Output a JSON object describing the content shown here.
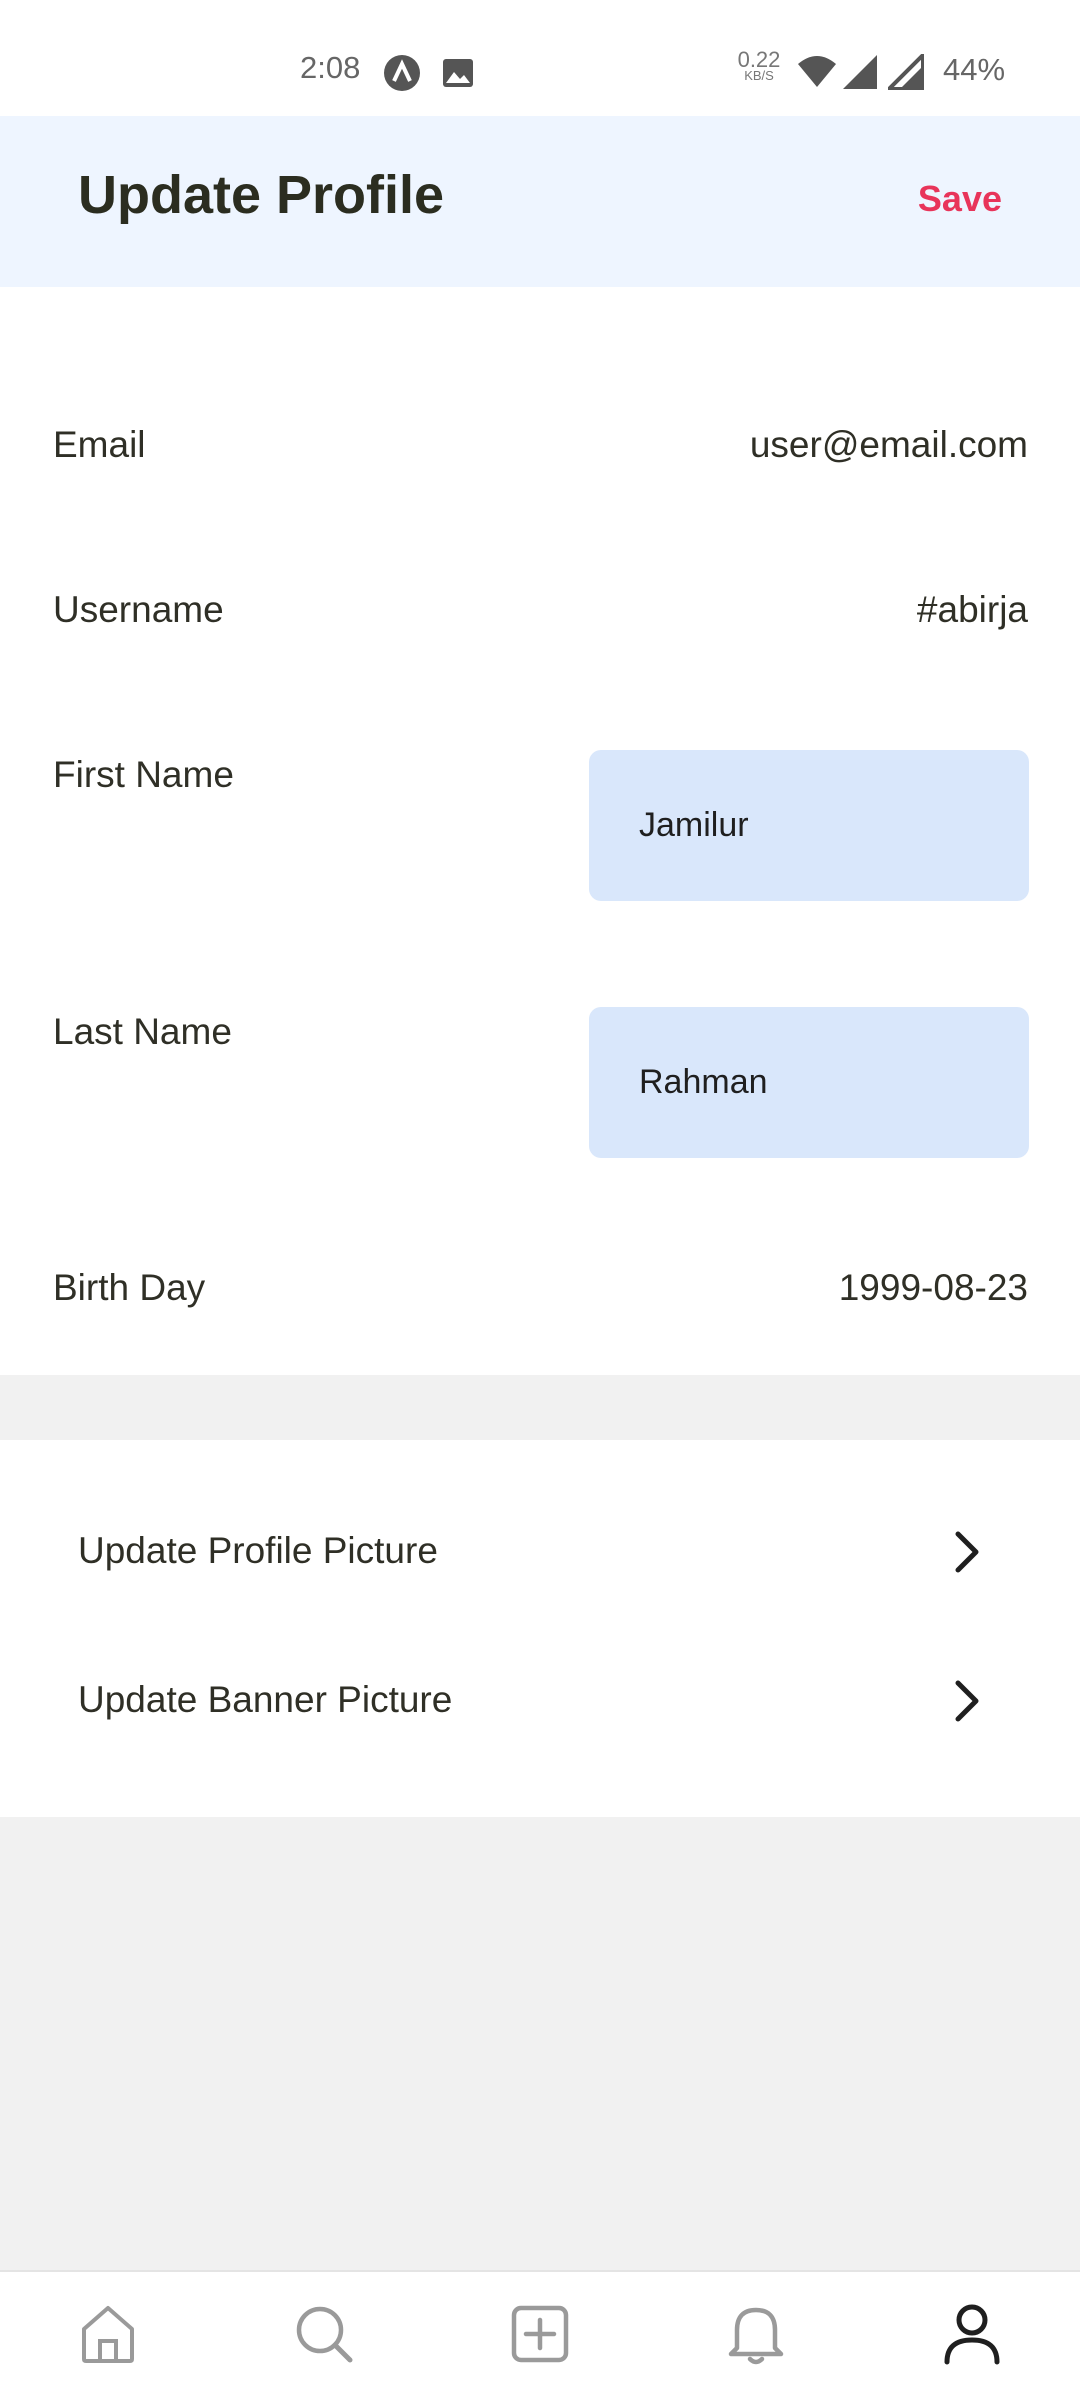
{
  "status_bar": {
    "time": "2:08",
    "net_speed_value": "0.22",
    "net_speed_unit": "KB/S",
    "battery": "44%",
    "icons": [
      "app-notification-icon",
      "image-notification-icon",
      "wifi-icon",
      "signal-icon",
      "signal-icon",
      "battery"
    ]
  },
  "header": {
    "title": "Update Profile",
    "save_label": "Save"
  },
  "form": {
    "email": {
      "label": "Email",
      "value": "user@email.com"
    },
    "username": {
      "label": "Username",
      "value": "#abirja"
    },
    "first_name": {
      "label": "First Name",
      "value": "Jamilur"
    },
    "last_name": {
      "label": "Last Name",
      "value": "Rahman"
    },
    "birth_day": {
      "label": "Birth Day",
      "value": "1999-08-23"
    }
  },
  "links": [
    {
      "label": "Update Profile Picture",
      "icon": "chevron-right-icon"
    },
    {
      "label": "Update Banner Picture",
      "icon": "chevron-right-icon"
    }
  ],
  "bottom_nav": [
    {
      "name": "home",
      "icon": "home-icon",
      "active": false
    },
    {
      "name": "search",
      "icon": "search-icon",
      "active": false
    },
    {
      "name": "add",
      "icon": "add-icon",
      "active": false
    },
    {
      "name": "notifications",
      "icon": "bell-icon",
      "active": false
    },
    {
      "name": "profile",
      "icon": "profile-icon",
      "active": true
    }
  ],
  "colors": {
    "accent": "#e8345a",
    "header_bg": "#eef5ff",
    "input_bg": "#d9e7fb",
    "page_bg": "#f1f1f1"
  }
}
